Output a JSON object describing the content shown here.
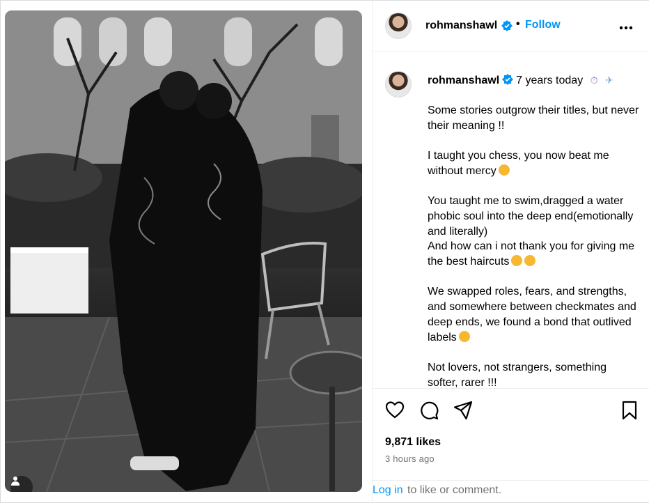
{
  "post": {
    "username": "rohmanshawl",
    "follow_label": "Follow",
    "separator": "•",
    "headline": "7 years today",
    "caption": [
      "Some stories outgrow their titles, but never their meaning !!",
      "I taught you chess, you now beat me without mercy",
      "You taught me to swim,dragged a water phobic soul into the deep end(emotionally and literally)\nAnd how can i not thank you for giving me the best haircuts",
      "We swapped roles, fears, and strengths, and somewhere between checkmates and deep ends, we found a bond that outlived labels",
      "Not lovers, not strangers, something softer, rarer !!!"
    ],
    "likes": "9,871 likes",
    "timestamp": "3 hours ago"
  },
  "footer": {
    "login_link": "Log in",
    "login_rest": "to like or comment."
  },
  "icons": {
    "verified": "verified-badge-icon",
    "more": "more-options-icon",
    "like": "heart-icon",
    "comment": "comment-icon",
    "share": "share-icon",
    "save": "bookmark-icon",
    "tagged_users": "user-tag-icon"
  },
  "colors": {
    "accent": "#0095f6",
    "muted": "#737373",
    "border": "#efefef"
  }
}
